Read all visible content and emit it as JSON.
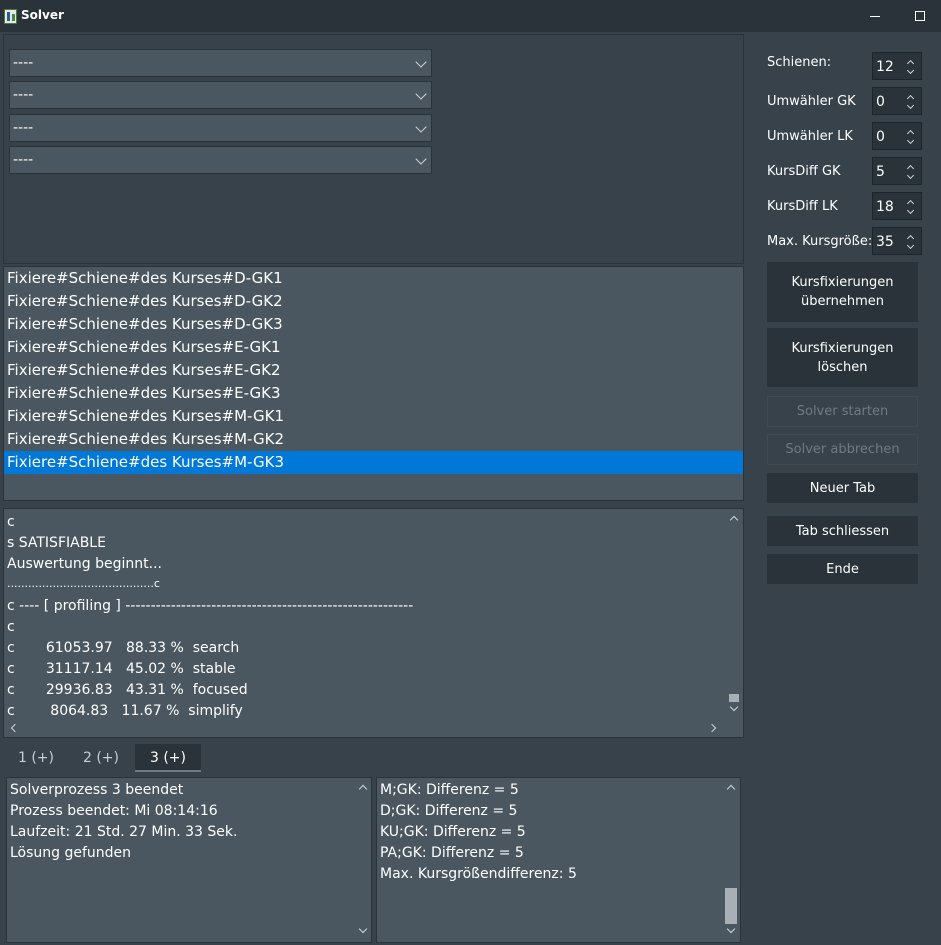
{
  "window": {
    "title": "Solver"
  },
  "dropdowns": [
    "----",
    "----",
    "----",
    "----"
  ],
  "fix_list": {
    "items": [
      "Fixiere#Schiene#des Kurses#D-GK1",
      "Fixiere#Schiene#des Kurses#D-GK2",
      "Fixiere#Schiene#des Kurses#D-GK3",
      "Fixiere#Schiene#des Kurses#E-GK1",
      "Fixiere#Schiene#des Kurses#E-GK2",
      "Fixiere#Schiene#des Kurses#E-GK3",
      "Fixiere#Schiene#des Kurses#M-GK1",
      "Fixiere#Schiene#des Kurses#M-GK2",
      "Fixiere#Schiene#des Kurses#M-GK3"
    ],
    "selected_index": 8
  },
  "log": {
    "lines": [
      "c",
      "s SATISFIABLE",
      "Auswertung beginnt...",
      "..........................................c",
      "c ---- [ profiling ] ---------------------------------------------------------",
      "c",
      "c       61053.97   88.33 %  search",
      "c       31117.14   45.02 %  stable",
      "c       29936.83   43.31 %  focused",
      "c        8064.83   11.67 %  simplify"
    ]
  },
  "tabs": [
    {
      "label": "1 (+)",
      "active": false
    },
    {
      "label": "2 (+)",
      "active": false
    },
    {
      "label": "3 (+)",
      "active": true
    }
  ],
  "status_box": {
    "lines": [
      "Solverprozess 3 beendet",
      "Prozess beendet: Mi 08:14:16",
      "Laufzeit: 21 Std. 27 Min. 33 Sek.",
      "Lösung gefunden"
    ]
  },
  "result_box": {
    "lines": [
      "M;GK: Differenz = 5",
      "D;GK: Differenz = 5",
      "KU;GK: Differenz = 5",
      "PA;GK: Differenz = 5",
      "Max. Kursgrößendifferenz: 5"
    ]
  },
  "settings": [
    {
      "label": "Schienen:",
      "value": "12"
    },
    {
      "label": "Umwähler GK",
      "value": "0"
    },
    {
      "label": "Umwähler LK",
      "value": "0"
    },
    {
      "label": "KursDiff GK",
      "value": "5"
    },
    {
      "label": "KursDiff LK",
      "value": "18"
    },
    {
      "label": "Max. Kursgröße:",
      "value": "35"
    }
  ],
  "buttons": {
    "apply_fix": "Kursfixierungen übernehmen",
    "delete_fix": "Kursfixierungen löschen",
    "start_solver": "Solver starten",
    "stop_solver": "Solver abbrechen",
    "new_tab": "Neuer Tab",
    "close_tab": "Tab schliessen",
    "exit": "Ende"
  }
}
